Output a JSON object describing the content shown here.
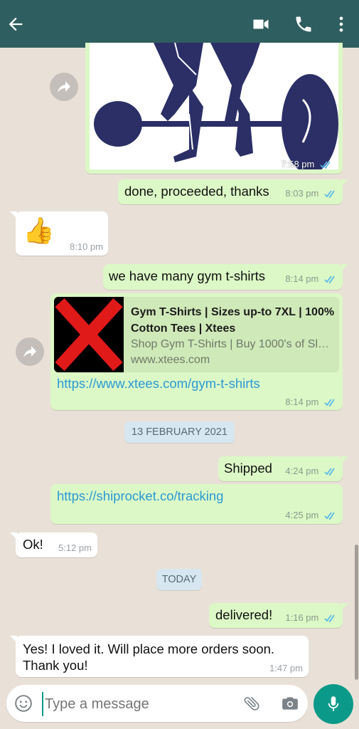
{
  "colors": {
    "header": "#2f5e60",
    "outgoing_bubble": "#dcf8c6",
    "incoming_bubble": "#ffffff",
    "read_ticks": "#4fb6ec",
    "link": "#2a9ad6",
    "mic_button": "#0b9a89",
    "chat_background": "#e9e1d7"
  },
  "header": {
    "back_icon": "arrow-left-icon",
    "video_icon": "video-camera-icon",
    "call_icon": "phone-icon",
    "menu_icon": "more-vertical-icon"
  },
  "messages": {
    "img_msg": {
      "time": "7:58 pm",
      "status": "read"
    },
    "m1": {
      "text": "done, proceeded, thanks",
      "time": "8:03 pm",
      "status": "read"
    },
    "m2": {
      "emoji": "👍",
      "time": "8:10 pm"
    },
    "m3": {
      "text": "we have many gym t-shirts",
      "time": "8:14 pm",
      "status": "read"
    },
    "m4": {
      "preview_title": "Gym T-Shirts | Sizes up-to 7XL | 100% Cotton Tees | Xtees",
      "preview_desc": "Shop Gym T-Shirts | Buy 1000's of Sl…",
      "preview_domain": "www.xtees.com",
      "url": "https://www.xtees.com/gym-t-shirts",
      "time": "8:14 pm",
      "status": "read"
    },
    "date1": "13 FEBRUARY 2021",
    "m5": {
      "text": "Shipped",
      "time": "4:24 pm",
      "status": "read"
    },
    "m6": {
      "url": "https://shiprocket.co/tracking",
      "time": "4:25 pm",
      "status": "read"
    },
    "m7": {
      "text": "Ok!",
      "time": "5:12 pm"
    },
    "date2": "TODAY",
    "m8": {
      "text": "delivered!",
      "time": "1:16 pm",
      "status": "read"
    },
    "m9": {
      "line1": "Yes! I loved it. Will place more orders soon.",
      "line2": "Thank you!",
      "time": "1:47 pm"
    }
  },
  "composer": {
    "placeholder": "Type a message",
    "emoji_icon": "emoji-icon",
    "attach_icon": "paperclip-icon",
    "camera_icon": "camera-icon",
    "mic_icon": "microphone-icon"
  }
}
